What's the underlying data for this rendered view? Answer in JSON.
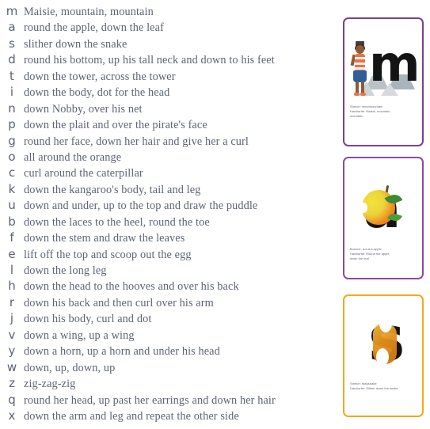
{
  "phrase_list": {
    "rows": [
      {
        "letter": "m",
        "phrase": "Maisie, mountain, mountain"
      },
      {
        "letter": "a",
        "phrase": "round the apple, down the leaf"
      },
      {
        "letter": "s",
        "phrase": "slither down the snake"
      },
      {
        "letter": "d",
        "phrase": "round his bottom, up his tall neck and down to his feet"
      },
      {
        "letter": "t",
        "phrase": "down the tower, across the tower"
      },
      {
        "letter": "i",
        "phrase": "down the body, dot for the head"
      },
      {
        "letter": "n",
        "phrase": "down Nobby, over his net"
      },
      {
        "letter": "p",
        "phrase": "down the plait and over the pirate's face"
      },
      {
        "letter": "g",
        "phrase": "round her face, down her hair and give her a curl"
      },
      {
        "letter": "o",
        "phrase": "all around the orange"
      },
      {
        "letter": "c",
        "phrase": "curl around the caterpillar"
      },
      {
        "letter": "k",
        "phrase": "down the kangaroo's body, tail and leg"
      },
      {
        "letter": "u",
        "phrase": "down and under, up to the top and draw the puddle"
      },
      {
        "letter": "b",
        "phrase": "down the laces to the heel, round the toe"
      },
      {
        "letter": "f",
        "phrase": "down the stem and draw the leaves"
      },
      {
        "letter": "e",
        "phrase": "lift off the top and scoop out the egg"
      },
      {
        "letter": "l",
        "phrase": "down the long leg"
      },
      {
        "letter": "h",
        "phrase": "down the head to the hooves and over his back"
      },
      {
        "letter": "r",
        "phrase": "down his back and then curl over his arm"
      },
      {
        "letter": "j",
        "phrase": "down his body, curl and dot"
      },
      {
        "letter": "v",
        "phrase": "down a wing, up a wing"
      },
      {
        "letter": "y",
        "phrase": "down a horn, up a horn and under his head"
      },
      {
        "letter": "w",
        "phrase": "down, up, down, up"
      },
      {
        "letter": "z",
        "phrase": "zig-zag-zig"
      },
      {
        "letter": "q",
        "phrase": "round her head, up past her earrings and down her hair"
      },
      {
        "letter": "x",
        "phrase": "down the arm and leg and repeat the other side"
      }
    ]
  },
  "cards": [
    {
      "id": "card-m",
      "letter": "m",
      "border_color": "#7b3f8f",
      "caption_lines": [
        "Stretch: mmmmountain",
        "Handwrite: Maisie, mountain,",
        "mountain"
      ],
      "artwork": "maisie-and-mountains"
    },
    {
      "id": "card-a",
      "letter": "a",
      "border_color": "#8e4a9e",
      "caption_lines": [
        "Bounce: a-a-a-a-apple",
        "Handwrite: Round the apple,",
        "down the leaf"
      ],
      "artwork": "apple"
    },
    {
      "id": "card-s",
      "letter": "s",
      "border_color": "#f3a81c",
      "caption_lines": [
        "Stretch: sssssnake",
        "Handwrite: Slither down the snake"
      ],
      "artwork": "snake"
    }
  ],
  "colors": {
    "text": "#5d6475",
    "letter": "#5a6275",
    "page_background": "#ffffff",
    "card_purple": "#7b3f8f",
    "card_orange": "#f3a81c"
  }
}
